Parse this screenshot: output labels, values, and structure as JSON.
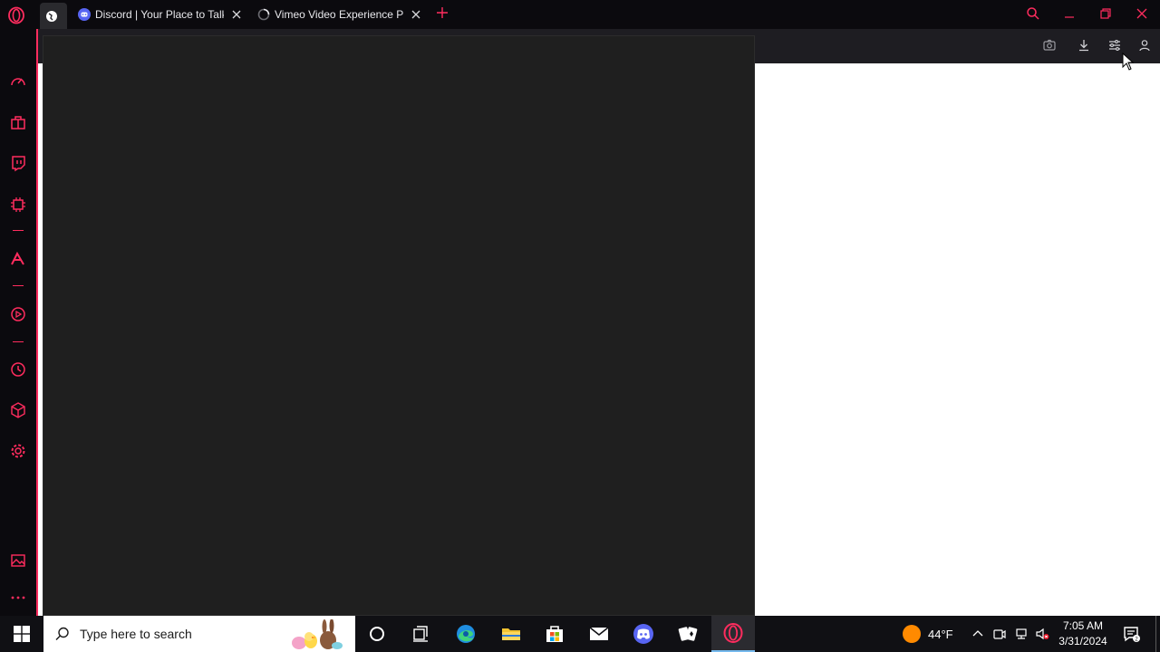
{
  "browser": {
    "tabs": [
      {
        "title": "Discord | Your Place to Talk",
        "favicon": "discord-icon"
      },
      {
        "title": "Vimeo Video Experience Pl",
        "favicon": "loading-spinner-icon"
      }
    ],
    "accent_color": "#ff2c5e"
  },
  "taskbar": {
    "search_placeholder": "Type here to search",
    "pinned_apps": [
      "cortana",
      "task-view",
      "edge",
      "file-explorer",
      "microsoft-store",
      "mail",
      "discord",
      "solitaire",
      "opera"
    ],
    "weather": {
      "temp": "44°F"
    },
    "clock": {
      "time": "7:05 AM",
      "date": "3/31/2024"
    }
  }
}
